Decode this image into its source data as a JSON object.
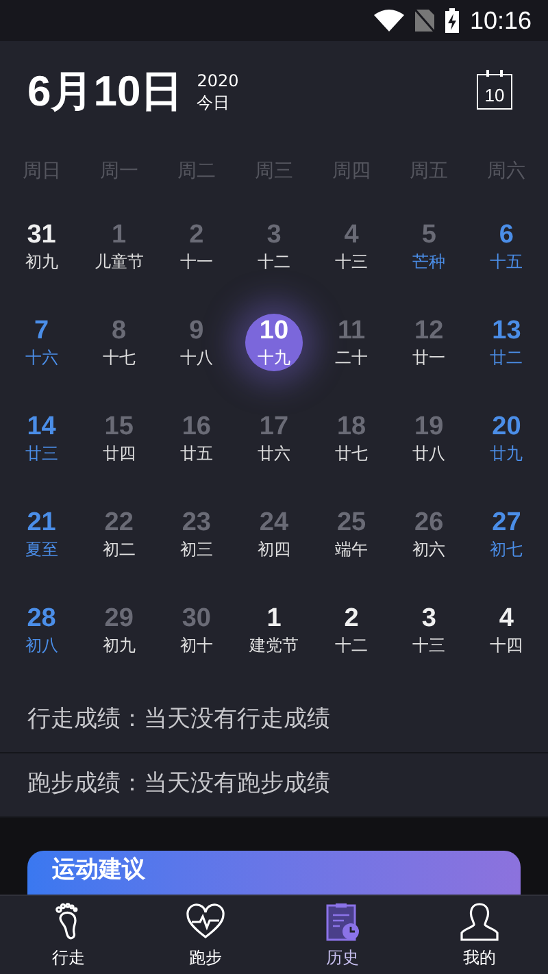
{
  "status_bar": {
    "time": "10:16"
  },
  "header": {
    "date": "6月10日",
    "year": "2020",
    "today_label": "今日",
    "calendar_button": "10"
  },
  "weekdays": [
    "周日",
    "周一",
    "周二",
    "周三",
    "周四",
    "周五",
    "周六"
  ],
  "days": [
    {
      "day": "31",
      "lunar": "初九",
      "kind": "other",
      "lunar_accent": false,
      "selected": false
    },
    {
      "day": "1",
      "lunar": "儿童节",
      "kind": "weekday",
      "lunar_accent": false,
      "selected": false
    },
    {
      "day": "2",
      "lunar": "十一",
      "kind": "weekday",
      "lunar_accent": false,
      "selected": false
    },
    {
      "day": "3",
      "lunar": "十二",
      "kind": "weekday",
      "lunar_accent": false,
      "selected": false
    },
    {
      "day": "4",
      "lunar": "十三",
      "kind": "weekday",
      "lunar_accent": false,
      "selected": false
    },
    {
      "day": "5",
      "lunar": "芒种",
      "kind": "weekday",
      "lunar_accent": true,
      "selected": false
    },
    {
      "day": "6",
      "lunar": "十五",
      "kind": "weekend",
      "lunar_accent": true,
      "selected": false
    },
    {
      "day": "7",
      "lunar": "十六",
      "kind": "weekend",
      "lunar_accent": true,
      "selected": false
    },
    {
      "day": "8",
      "lunar": "十七",
      "kind": "weekday",
      "lunar_accent": false,
      "selected": false
    },
    {
      "day": "9",
      "lunar": "十八",
      "kind": "weekday",
      "lunar_accent": false,
      "selected": false
    },
    {
      "day": "10",
      "lunar": "十九",
      "kind": "weekday",
      "lunar_accent": false,
      "selected": true
    },
    {
      "day": "11",
      "lunar": "二十",
      "kind": "weekday",
      "lunar_accent": false,
      "selected": false
    },
    {
      "day": "12",
      "lunar": "廿一",
      "kind": "weekday",
      "lunar_accent": false,
      "selected": false
    },
    {
      "day": "13",
      "lunar": "廿二",
      "kind": "weekend",
      "lunar_accent": true,
      "selected": false
    },
    {
      "day": "14",
      "lunar": "廿三",
      "kind": "weekend",
      "lunar_accent": true,
      "selected": false
    },
    {
      "day": "15",
      "lunar": "廿四",
      "kind": "weekday",
      "lunar_accent": false,
      "selected": false
    },
    {
      "day": "16",
      "lunar": "廿五",
      "kind": "weekday",
      "lunar_accent": false,
      "selected": false
    },
    {
      "day": "17",
      "lunar": "廿六",
      "kind": "weekday",
      "lunar_accent": false,
      "selected": false
    },
    {
      "day": "18",
      "lunar": "廿七",
      "kind": "weekday",
      "lunar_accent": false,
      "selected": false
    },
    {
      "day": "19",
      "lunar": "廿八",
      "kind": "weekday",
      "lunar_accent": false,
      "selected": false
    },
    {
      "day": "20",
      "lunar": "廿九",
      "kind": "weekend",
      "lunar_accent": true,
      "selected": false
    },
    {
      "day": "21",
      "lunar": "夏至",
      "kind": "weekend",
      "lunar_accent": true,
      "selected": false
    },
    {
      "day": "22",
      "lunar": "初二",
      "kind": "weekday",
      "lunar_accent": false,
      "selected": false
    },
    {
      "day": "23",
      "lunar": "初三",
      "kind": "weekday",
      "lunar_accent": false,
      "selected": false
    },
    {
      "day": "24",
      "lunar": "初四",
      "kind": "weekday",
      "lunar_accent": false,
      "selected": false
    },
    {
      "day": "25",
      "lunar": "端午",
      "kind": "weekday",
      "lunar_accent": false,
      "selected": false
    },
    {
      "day": "26",
      "lunar": "初六",
      "kind": "weekday",
      "lunar_accent": false,
      "selected": false
    },
    {
      "day": "27",
      "lunar": "初七",
      "kind": "weekend",
      "lunar_accent": true,
      "selected": false
    },
    {
      "day": "28",
      "lunar": "初八",
      "kind": "weekend",
      "lunar_accent": true,
      "selected": false
    },
    {
      "day": "29",
      "lunar": "初九",
      "kind": "weekday",
      "lunar_accent": false,
      "selected": false
    },
    {
      "day": "30",
      "lunar": "初十",
      "kind": "weekday",
      "lunar_accent": false,
      "selected": false
    },
    {
      "day": "1",
      "lunar": "建党节",
      "kind": "other",
      "lunar_accent": false,
      "selected": false
    },
    {
      "day": "2",
      "lunar": "十二",
      "kind": "other",
      "lunar_accent": false,
      "selected": false
    },
    {
      "day": "3",
      "lunar": "十三",
      "kind": "other",
      "lunar_accent": false,
      "selected": false
    },
    {
      "day": "4",
      "lunar": "十四",
      "kind": "other",
      "lunar_accent": false,
      "selected": false
    }
  ],
  "results": [
    "行走成绩：当天没有行走成绩",
    "跑步成绩：当天没有跑步成绩"
  ],
  "advice_card": {
    "title": "运动建议"
  },
  "nav": [
    {
      "label": "行走",
      "selected": false
    },
    {
      "label": "跑步",
      "selected": false
    },
    {
      "label": "历史",
      "selected": true
    },
    {
      "label": "我的",
      "selected": false
    }
  ]
}
